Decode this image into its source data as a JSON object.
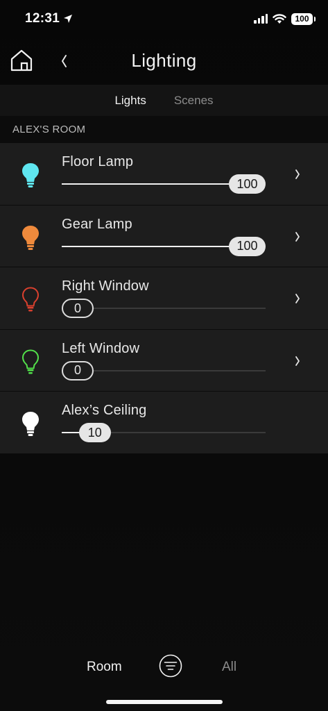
{
  "status_bar": {
    "time": "12:31",
    "battery": "100",
    "location_icon": "location-arrow-icon",
    "signal_icon": "cellular-signal-icon",
    "wifi_icon": "wifi-icon"
  },
  "header": {
    "title": "Lighting",
    "home_icon": "home-icon",
    "back_icon": "chevron-left-icon"
  },
  "tabs": [
    {
      "label": "Lights",
      "active": true
    },
    {
      "label": "Scenes",
      "active": false
    }
  ],
  "section": {
    "label": "ALEX'S ROOM"
  },
  "lights": [
    {
      "name": "Floor Lamp",
      "level": "100",
      "level_fraction": 1.0,
      "color": "#5fe6f0",
      "has_detail": true
    },
    {
      "name": "Gear Lamp",
      "level": "100",
      "level_fraction": 1.0,
      "color": "#ef8a3c",
      "has_detail": true
    },
    {
      "name": "Right Window",
      "level": "0",
      "level_fraction": 0.0,
      "color": "#d9402e",
      "has_detail": true
    },
    {
      "name": "Left Window",
      "level": "0",
      "level_fraction": 0.0,
      "color": "#52e04a",
      "has_detail": true
    },
    {
      "name": "Alex’s Ceiling",
      "level": "10",
      "level_fraction": 0.1,
      "color": "#ffffff",
      "has_detail": false
    }
  ],
  "bottom_bar": {
    "room_label": "Room",
    "all_label": "All",
    "filter_icon": "filter-icon"
  }
}
